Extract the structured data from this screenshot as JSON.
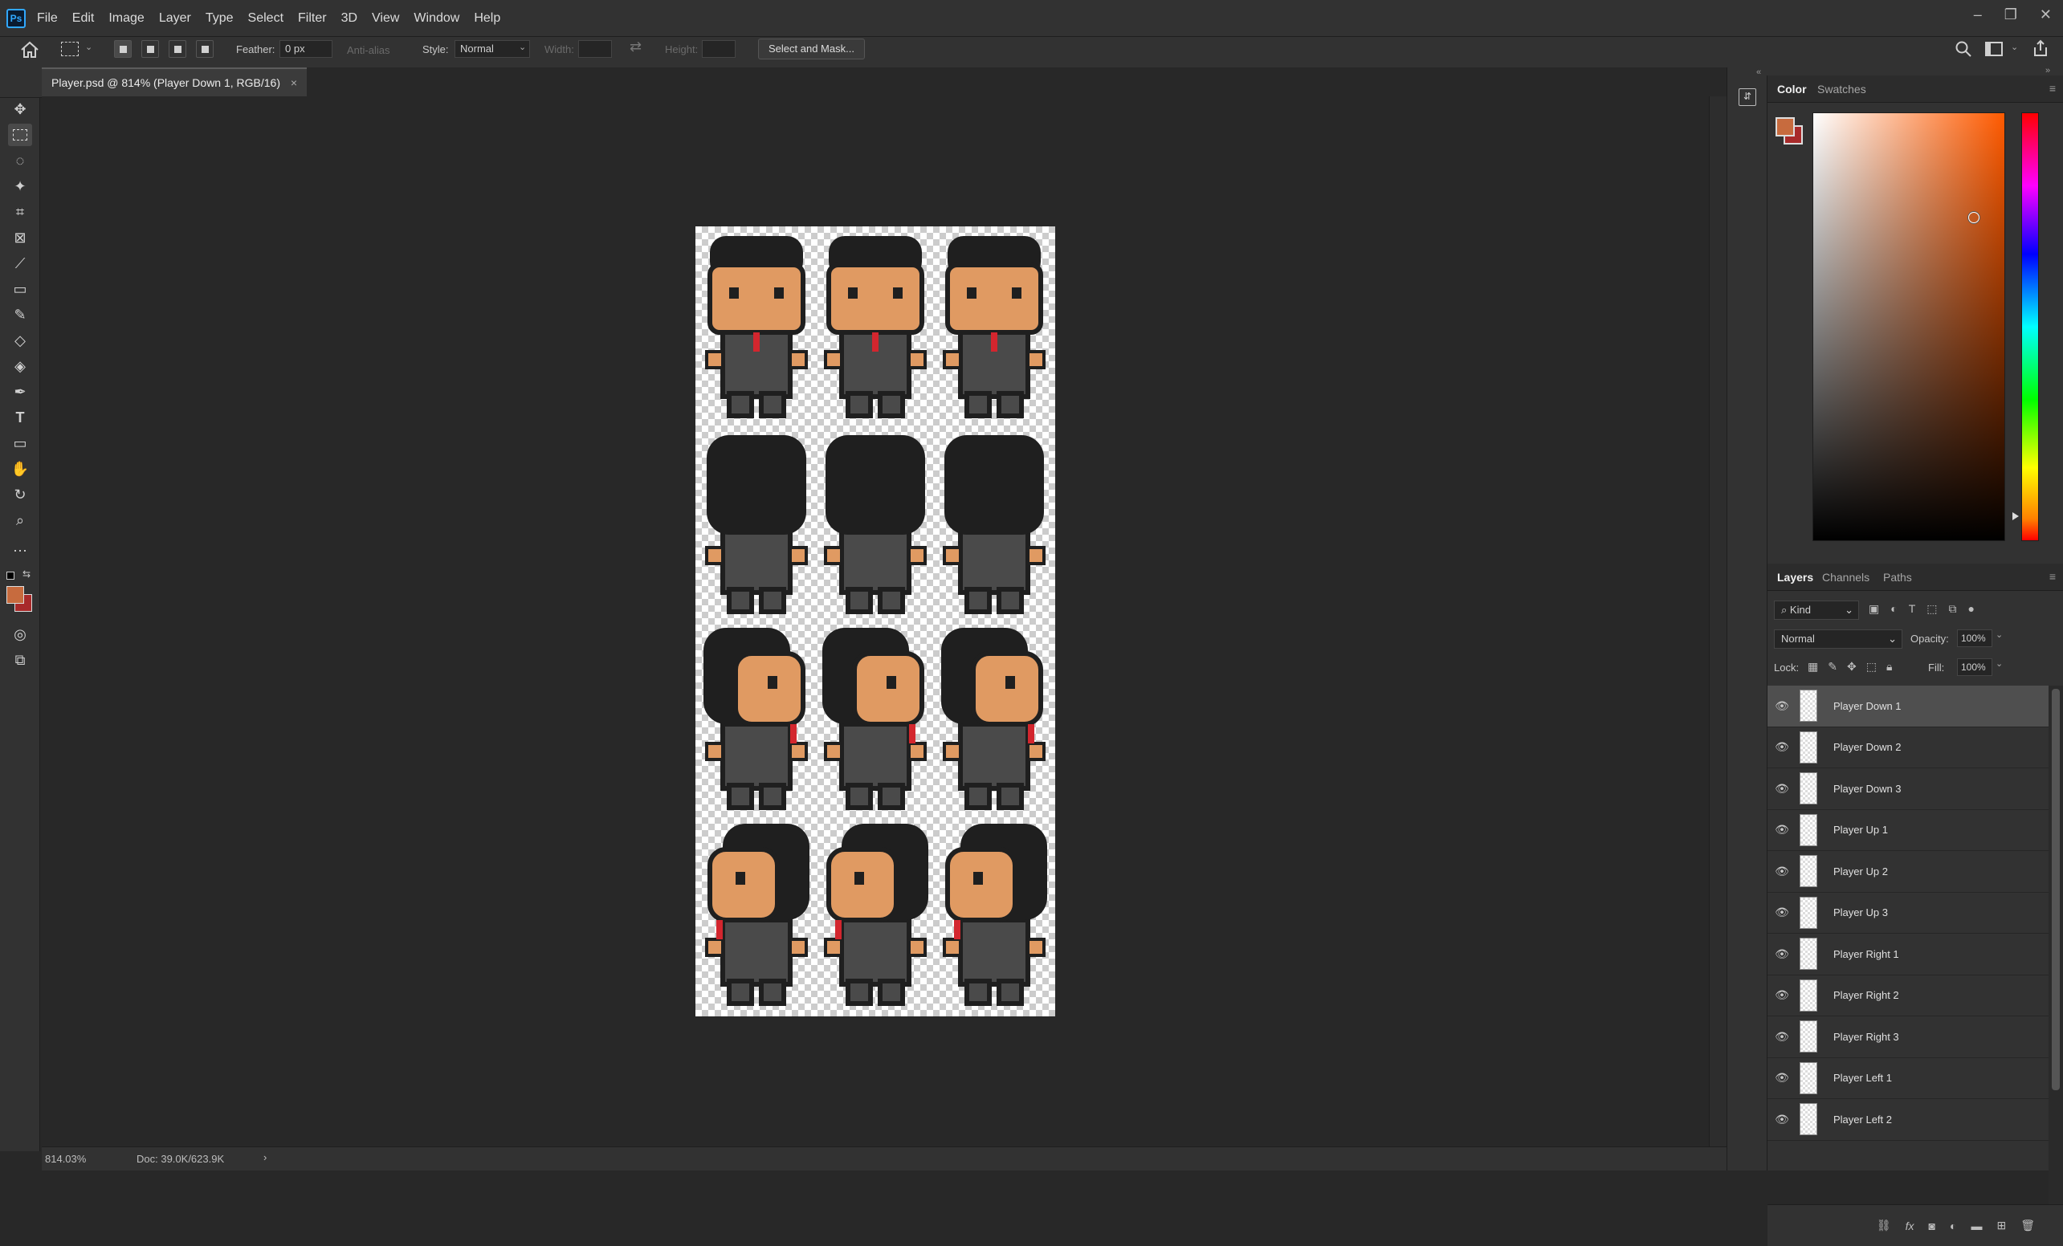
{
  "menubar": {
    "logo": "Ps",
    "items": [
      "File",
      "Edit",
      "Image",
      "Layer",
      "Type",
      "Select",
      "Filter",
      "3D",
      "View",
      "Window",
      "Help"
    ],
    "window_controls": [
      "–",
      "❐",
      "✕"
    ]
  },
  "options": {
    "feather_label": "Feather:",
    "feather_value": "0 px",
    "antialias_label": "Anti-alias",
    "style_label": "Style:",
    "style_value": "Normal",
    "width_label": "Width:",
    "height_label": "Height:",
    "select_mask_label": "Select and Mask..."
  },
  "document": {
    "tab_title": "Player.psd @ 814% (Player Down 1, RGB/16)",
    "close": "×"
  },
  "status": {
    "zoom": "814.03%",
    "doc_size": "Doc: 39.0K/623.9K",
    "arrow": "›"
  },
  "color_panel": {
    "tabs": [
      "Color",
      "Swatches"
    ],
    "foreground": "#c76b3e",
    "background": "#a82a2a"
  },
  "layers_panel": {
    "tabs": [
      "Layers",
      "Channels",
      "Paths"
    ],
    "kind_label": "Kind",
    "blend_mode": "Normal",
    "opacity_label": "Opacity:",
    "opacity_value": "100%",
    "lock_label": "Lock:",
    "fill_label": "Fill:",
    "fill_value": "100%",
    "layers": [
      {
        "name": "Player Down 1",
        "selected": true
      },
      {
        "name": "Player Down 2",
        "selected": false
      },
      {
        "name": "Player Down 3",
        "selected": false
      },
      {
        "name": "Player Up 1",
        "selected": false
      },
      {
        "name": "Player Up 2",
        "selected": false
      },
      {
        "name": "Player Up 3",
        "selected": false
      },
      {
        "name": "Player Right 1",
        "selected": false
      },
      {
        "name": "Player Right 2",
        "selected": false
      },
      {
        "name": "Player Right 3",
        "selected": false
      },
      {
        "name": "Player Left 1",
        "selected": false
      },
      {
        "name": "Player Left 2",
        "selected": false
      }
    ]
  },
  "sprite_colors": {
    "hair": "#1f1f1f",
    "skin": "#e09a62",
    "suit": "#4a4a4a",
    "outline": "#1f1f1f",
    "tie": "#d3262e"
  }
}
